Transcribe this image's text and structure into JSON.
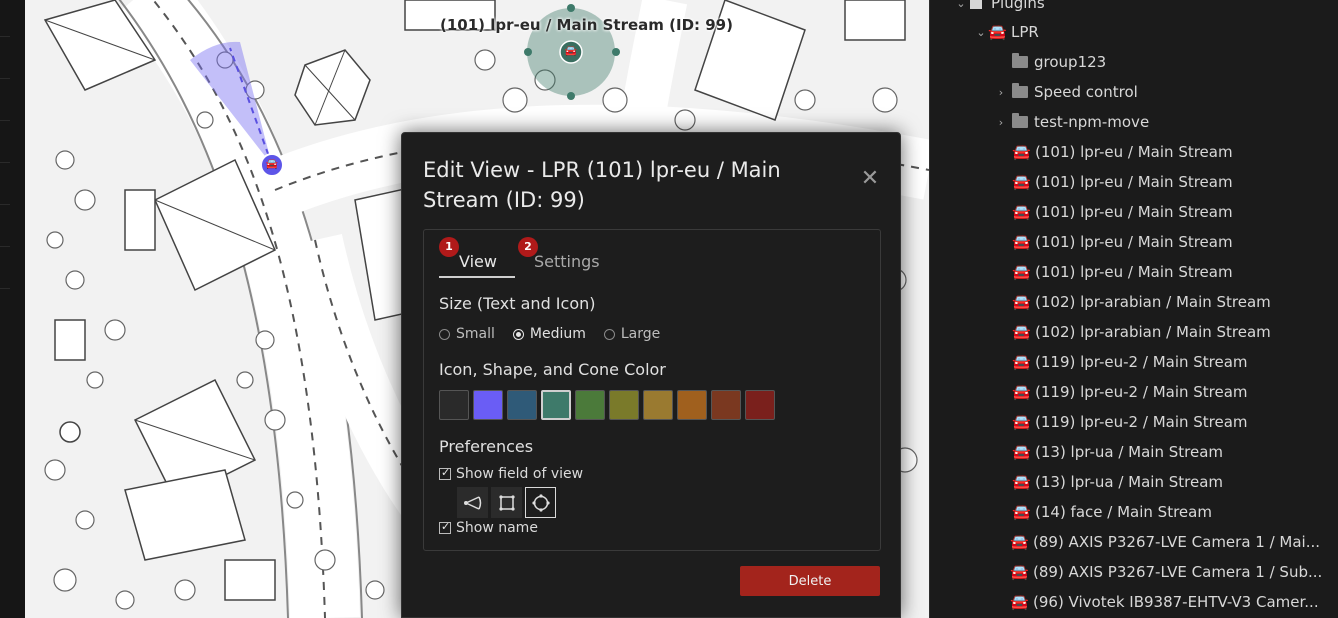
{
  "map": {
    "camera_label": "(101) lpr-eu / Main Stream (ID: 99)"
  },
  "dialog": {
    "title": "Edit View - LPR (101) lpr-eu / Main Stream (ID: 99)",
    "close_icon": "close-icon",
    "tabs": [
      {
        "label": "View",
        "badge": "1",
        "active": true
      },
      {
        "label": "Settings",
        "badge": "2",
        "active": false
      }
    ],
    "size_label": "Size (Text and Icon)",
    "size_options": [
      "Small",
      "Medium",
      "Large"
    ],
    "size_selected": "Medium",
    "color_label": "Icon, Shape, and Cone Color",
    "colors": [
      "#2a2a2a",
      "#6a5df5",
      "#2f5a78",
      "#3e7a6a",
      "#4b7a3a",
      "#7a7a2a",
      "#9a7a30",
      "#a0601e",
      "#7a3820",
      "#7a201c"
    ],
    "selected_color": "#3e7a6a",
    "preferences_label": "Preferences",
    "show_fov_label": "Show field of view",
    "show_fov_checked": true,
    "shape_icons": [
      "cone-shape-icon",
      "square-shape-icon",
      "circle-shape-icon"
    ],
    "selected_shape": "circle-shape-icon",
    "show_name_label": "Show name",
    "show_name_checked": true,
    "delete_label": "Delete"
  },
  "tree": {
    "root_label": "Plugins",
    "lpr_label": "LPR",
    "folders": [
      "group123",
      "Speed control",
      "test-npm-move"
    ],
    "items": [
      "(101) lpr-eu / Main Stream",
      "(101) lpr-eu / Main Stream",
      "(101) lpr-eu / Main Stream",
      "(101) lpr-eu / Main Stream",
      "(101) lpr-eu / Main Stream",
      "(102) lpr-arabian / Main Stream",
      "(102) lpr-arabian / Main Stream",
      "(119) lpr-eu-2 / Main Stream",
      "(119) lpr-eu-2 / Main Stream",
      "(119) lpr-eu-2 / Main Stream",
      "(13) lpr-ua / Main Stream",
      "(13) lpr-ua / Main Stream",
      "(14) face / Main Stream"
    ],
    "outer_items": [
      "(89) AXIS P3267-LVE Camera 1 / Mai...",
      "(89) AXIS P3267-LVE Camera 1 / Sub...",
      "(96) Vivotek IB9387-EHTV-V3 Camer..."
    ]
  }
}
